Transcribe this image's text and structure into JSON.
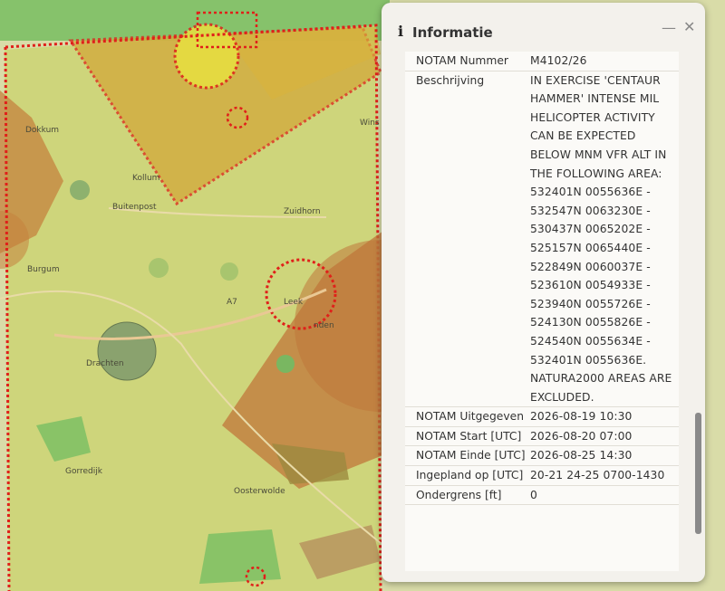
{
  "map": {
    "labels": [
      "Dokkum",
      "Buitenpost",
      "Zuidhorn",
      "Burgum",
      "Leek",
      "A7",
      "Drachten",
      "Gorredijk",
      "Oosterwolde",
      "Wins",
      "Kollum",
      "nden"
    ]
  },
  "panel": {
    "icon": "info-icon",
    "title": "Informatie",
    "minimize_glyph": "—",
    "close_glyph": "✕",
    "rows": [
      {
        "key": "NOTAM Nummer",
        "value": "M4102/26"
      },
      {
        "key": "Beschrijving",
        "value": "IN EXERCISE 'CENTAUR HAMMER' INTENSE MIL HELICOPTER ACTIVITY CAN BE EXPECTED BELOW MNM VFR ALT IN THE FOLLOWING AREA: 532401N 0055636E - 532547N 0063230E - 530437N 0065202E - 525157N 0065440E - 522849N 0060037E - 523610N 0054933E - 523940N 0055726E - 524130N 0055826E - 524540N 0055634E - 532401N 0055636E. NATURA2000 AREAS ARE EXCLUDED."
      },
      {
        "key": "NOTAM Uitgegeven",
        "value": "2026-08-19 10:30"
      },
      {
        "key": "NOTAM Start [UTC]",
        "value": "2026-08-20 07:00"
      },
      {
        "key": "NOTAM Einde [UTC]",
        "value": "2026-08-25 14:30"
      },
      {
        "key": "Ingepland op [UTC]",
        "value": "20-21 24-25 0700-1430"
      },
      {
        "key": "Ondergrens [ft]",
        "value": "0"
      }
    ]
  },
  "colors": {
    "restricted_red": "#e0201a",
    "danger_orange": "#c87a3a",
    "map_green": "#9ec46a"
  }
}
